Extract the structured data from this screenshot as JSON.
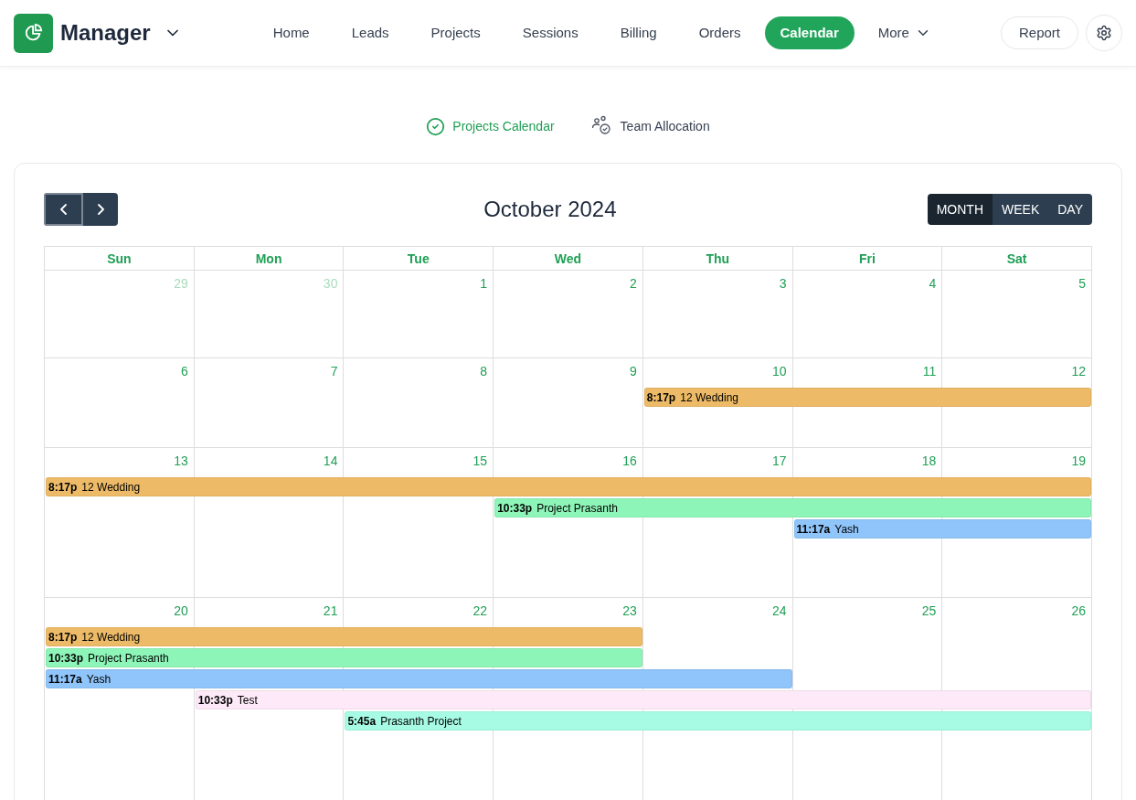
{
  "brand": {
    "name": "Manager"
  },
  "nav": [
    {
      "label": "Home",
      "selected": false
    },
    {
      "label": "Leads",
      "selected": false
    },
    {
      "label": "Projects",
      "selected": false
    },
    {
      "label": "Sessions",
      "selected": false
    },
    {
      "label": "Billing",
      "selected": false
    },
    {
      "label": "Orders",
      "selected": false
    },
    {
      "label": "Calendar",
      "selected": true
    },
    {
      "label": "More",
      "selected": false,
      "kind": "dropdown"
    }
  ],
  "report_button": "Report",
  "view_tabs": [
    {
      "label": "Projects Calendar",
      "selected": true,
      "kind": "check"
    },
    {
      "label": "Team Allocation",
      "selected": false,
      "kind": "team"
    }
  ],
  "calendar": {
    "title": "October 2024",
    "view_buttons": [
      {
        "label": "MONTH",
        "selected": true
      },
      {
        "label": "WEEK",
        "selected": false
      },
      {
        "label": "DAY",
        "selected": false
      }
    ],
    "weekdays": [
      "Sun",
      "Mon",
      "Tue",
      "Wed",
      "Thu",
      "Fri",
      "Sat"
    ],
    "weeks": [
      {
        "days": [
          {
            "date": "29",
            "outside_month": true
          },
          {
            "date": "30",
            "outside_month": true
          },
          {
            "date": "1",
            "outside_month": false
          },
          {
            "date": "2",
            "outside_month": false
          },
          {
            "date": "3",
            "outside_month": false
          },
          {
            "date": "4",
            "outside_month": false
          },
          {
            "date": "5",
            "outside_month": false
          }
        ]
      },
      {
        "days": [
          {
            "date": "6",
            "outside_month": false
          },
          {
            "date": "7",
            "outside_month": false
          },
          {
            "date": "8",
            "outside_month": false
          },
          {
            "date": "9",
            "outside_month": false
          },
          {
            "date": "10",
            "outside_month": false
          },
          {
            "date": "11",
            "outside_month": false
          },
          {
            "date": "12",
            "outside_month": false
          }
        ],
        "events": [
          {
            "time": "8:17p",
            "title": "12 Wedding",
            "color": "#edbb67",
            "cells": [
              {
                "kind": "free"
              },
              {
                "kind": "free"
              },
              {
                "kind": "free"
              },
              {
                "kind": "free"
              },
              {
                "kind": "covered"
              },
              {
                "kind": "covered"
              },
              {
                "kind": "covered"
              }
            ]
          }
        ]
      },
      {
        "days": [
          {
            "date": "13",
            "outside_month": false
          },
          {
            "date": "14",
            "outside_month": false
          },
          {
            "date": "15",
            "outside_month": false
          },
          {
            "date": "16",
            "outside_month": false
          },
          {
            "date": "17",
            "outside_month": false
          },
          {
            "date": "18",
            "outside_month": false
          },
          {
            "date": "19",
            "outside_month": false
          }
        ],
        "events": [
          {
            "time": "8:17p",
            "title": "12 Wedding",
            "color": "#edbb67",
            "cells": [
              {
                "kind": "covered"
              },
              {
                "kind": "covered"
              },
              {
                "kind": "covered"
              },
              {
                "kind": "covered"
              },
              {
                "kind": "covered"
              },
              {
                "kind": "covered"
              },
              {
                "kind": "covered"
              }
            ]
          },
          {
            "time": "10:33p",
            "title": "Project Prasanth",
            "color": "#8ef5b8",
            "cells": [
              {
                "kind": "free"
              },
              {
                "kind": "free"
              },
              {
                "kind": "free"
              },
              {
                "kind": "covered"
              },
              {
                "kind": "covered"
              },
              {
                "kind": "covered"
              },
              {
                "kind": "covered"
              }
            ]
          },
          {
            "time": "11:17a",
            "title": "Yash",
            "color": "#8fc5fa",
            "cells": [
              {
                "kind": "free"
              },
              {
                "kind": "free"
              },
              {
                "kind": "free"
              },
              {
                "kind": "free"
              },
              {
                "kind": "free"
              },
              {
                "kind": "covered"
              },
              {
                "kind": "covered"
              }
            ]
          }
        ]
      },
      {
        "days": [
          {
            "date": "20",
            "outside_month": false
          },
          {
            "date": "21",
            "outside_month": false
          },
          {
            "date": "22",
            "outside_month": false
          },
          {
            "date": "23",
            "outside_month": false
          },
          {
            "date": "24",
            "outside_month": false
          },
          {
            "date": "25",
            "outside_month": false
          },
          {
            "date": "26",
            "outside_month": false
          }
        ],
        "events": [
          {
            "time": "8:17p",
            "title": "12 Wedding",
            "color": "#edbb67",
            "cells": [
              {
                "kind": "covered"
              },
              {
                "kind": "covered"
              },
              {
                "kind": "covered"
              },
              {
                "kind": "covered"
              },
              {
                "kind": "free"
              },
              {
                "kind": "free"
              },
              {
                "kind": "free"
              }
            ]
          },
          {
            "time": "10:33p",
            "title": "Project Prasanth",
            "color": "#8ef5b8",
            "cells": [
              {
                "kind": "covered"
              },
              {
                "kind": "covered"
              },
              {
                "kind": "covered"
              },
              {
                "kind": "covered"
              },
              {
                "kind": "free"
              },
              {
                "kind": "free"
              },
              {
                "kind": "free"
              }
            ]
          },
          {
            "time": "11:17a",
            "title": "Yash",
            "color": "#8fc5fa",
            "cells": [
              {
                "kind": "covered"
              },
              {
                "kind": "covered"
              },
              {
                "kind": "covered"
              },
              {
                "kind": "covered"
              },
              {
                "kind": "covered"
              },
              {
                "kind": "free"
              },
              {
                "kind": "free"
              }
            ]
          },
          {
            "time": "10:33p",
            "title": "Test",
            "color": "#fde9f7",
            "cells": [
              {
                "kind": "free"
              },
              {
                "kind": "covered"
              },
              {
                "kind": "covered"
              },
              {
                "kind": "covered"
              },
              {
                "kind": "covered"
              },
              {
                "kind": "covered"
              },
              {
                "kind": "covered"
              }
            ]
          },
          {
            "time": "5:45a",
            "title": "Prasanth Project",
            "color": "#a7fbe5",
            "cells": [
              {
                "kind": "free"
              },
              {
                "kind": "free"
              },
              {
                "kind": "covered"
              },
              {
                "kind": "covered"
              },
              {
                "kind": "covered"
              },
              {
                "kind": "covered"
              },
              {
                "kind": "covered"
              }
            ]
          }
        ]
      }
    ]
  }
}
